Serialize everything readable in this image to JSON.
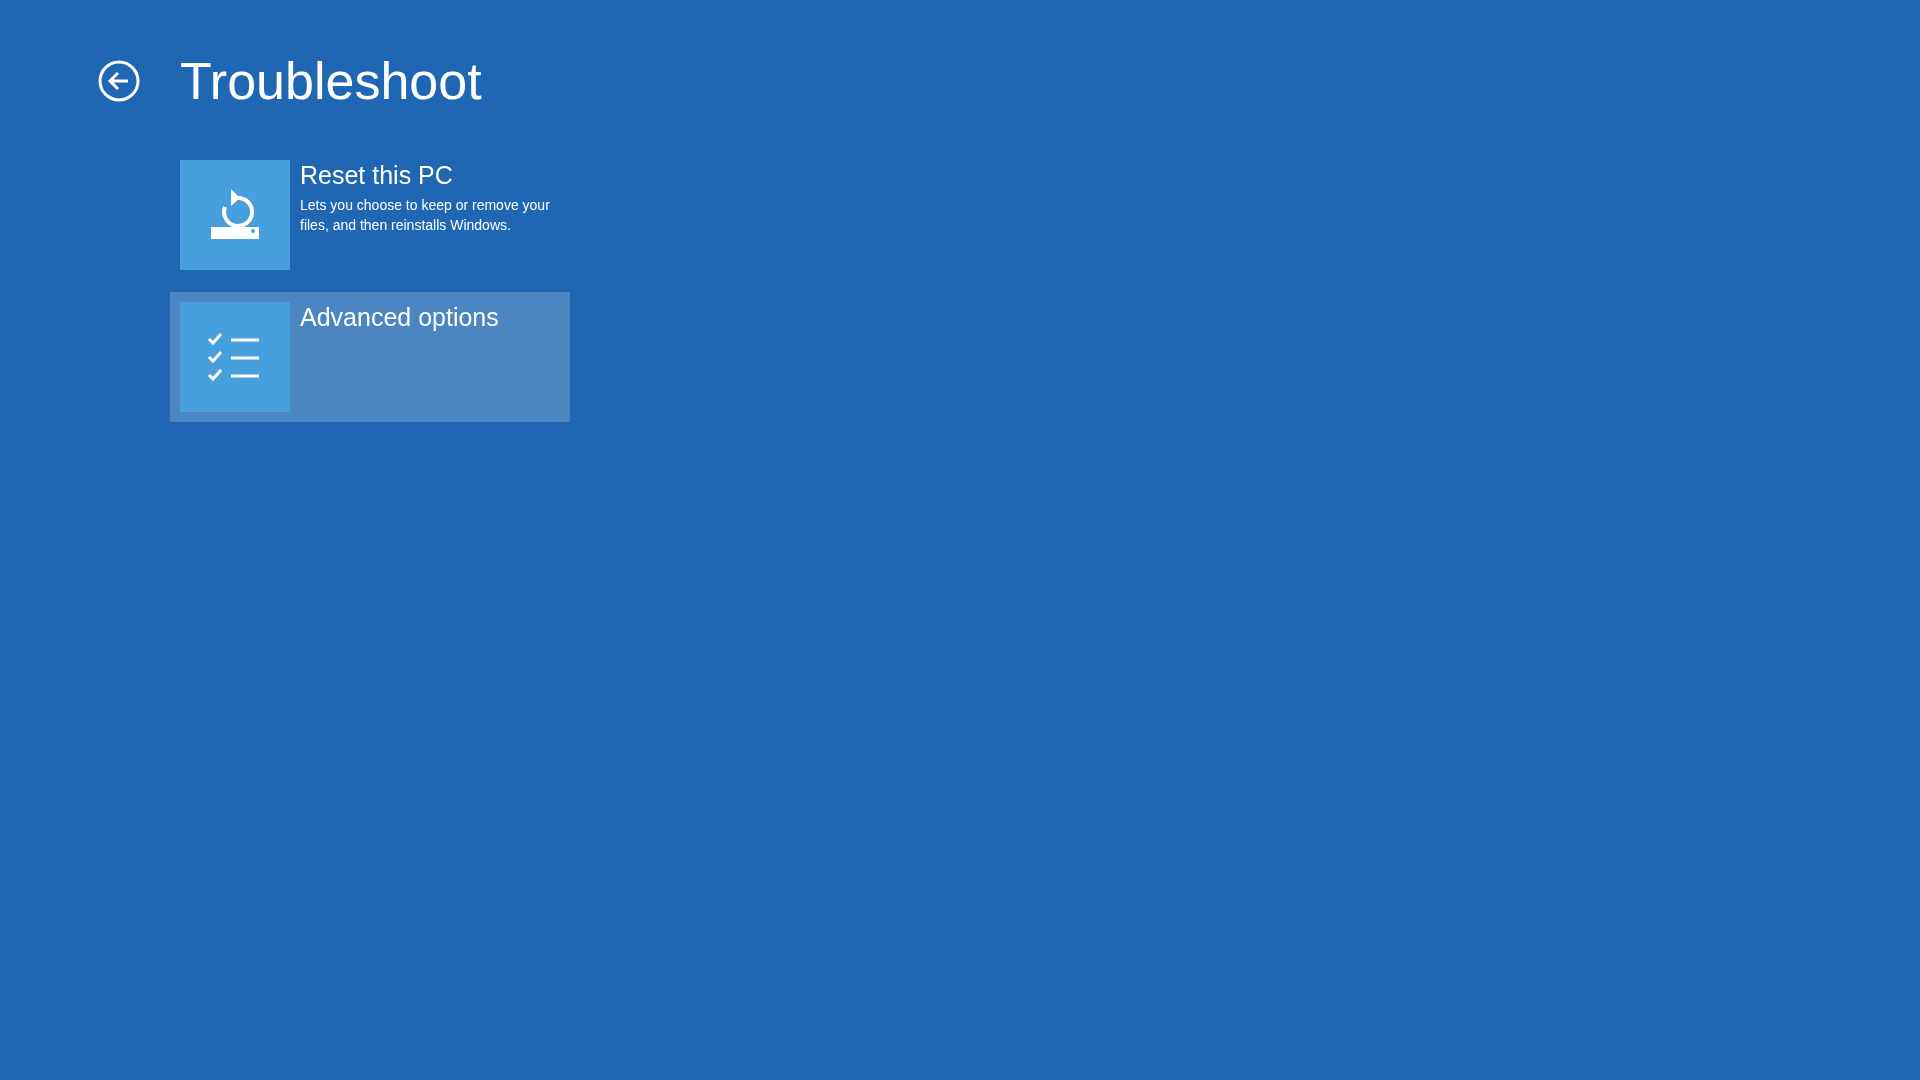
{
  "header": {
    "title": "Troubleshoot"
  },
  "options": [
    {
      "kind": "reset",
      "title": "Reset this PC",
      "description": "Lets you choose to keep or remove your files, and then reinstalls Windows.",
      "selected": false
    },
    {
      "kind": "advanced",
      "title": "Advanced options",
      "selected": true
    }
  ]
}
